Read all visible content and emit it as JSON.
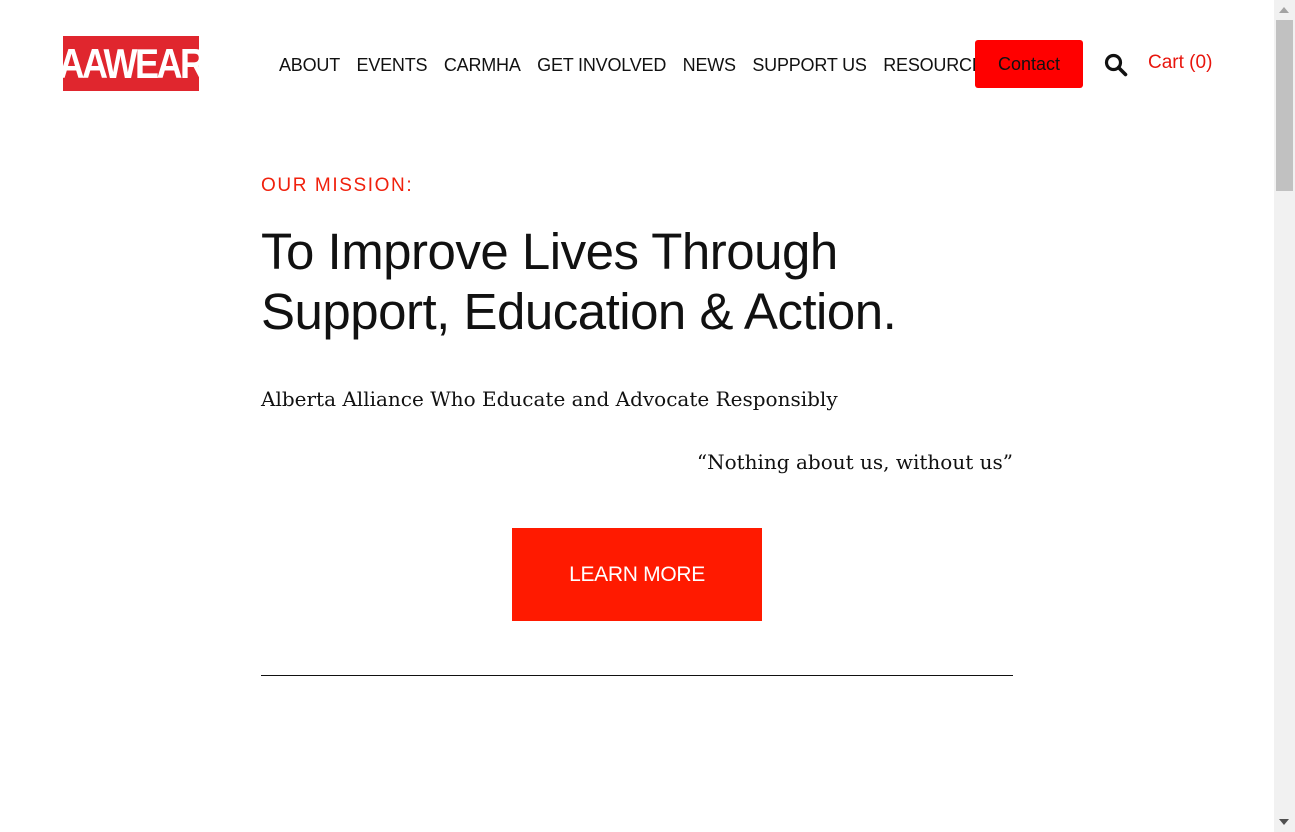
{
  "header": {
    "logo_text": "AAWEAR",
    "nav_items": [
      "ABOUT",
      "EVENTS",
      "CARMHA",
      "GET INVOLVED",
      "NEWS",
      "SUPPORT US",
      "RESOURCES"
    ],
    "contact_label": "Contact",
    "search_icon": "search-icon",
    "cart_label": "Cart (0)"
  },
  "hero": {
    "eyebrow": "OUR MISSION:",
    "headline_line1": "To Improve Lives Through",
    "headline_line2": "Support, Education & Action.",
    "subtitle": "Alberta Alliance Who Educate and Advocate Responsibly",
    "quote": "“Nothing about us, without us”",
    "cta_label": "LEARN MORE"
  },
  "colors": {
    "brand_red": "#e0262e",
    "accent_red": "#ff1a00",
    "contact_red": "#ff0000",
    "text_dark": "#111111",
    "cart_red": "#e8150d"
  }
}
